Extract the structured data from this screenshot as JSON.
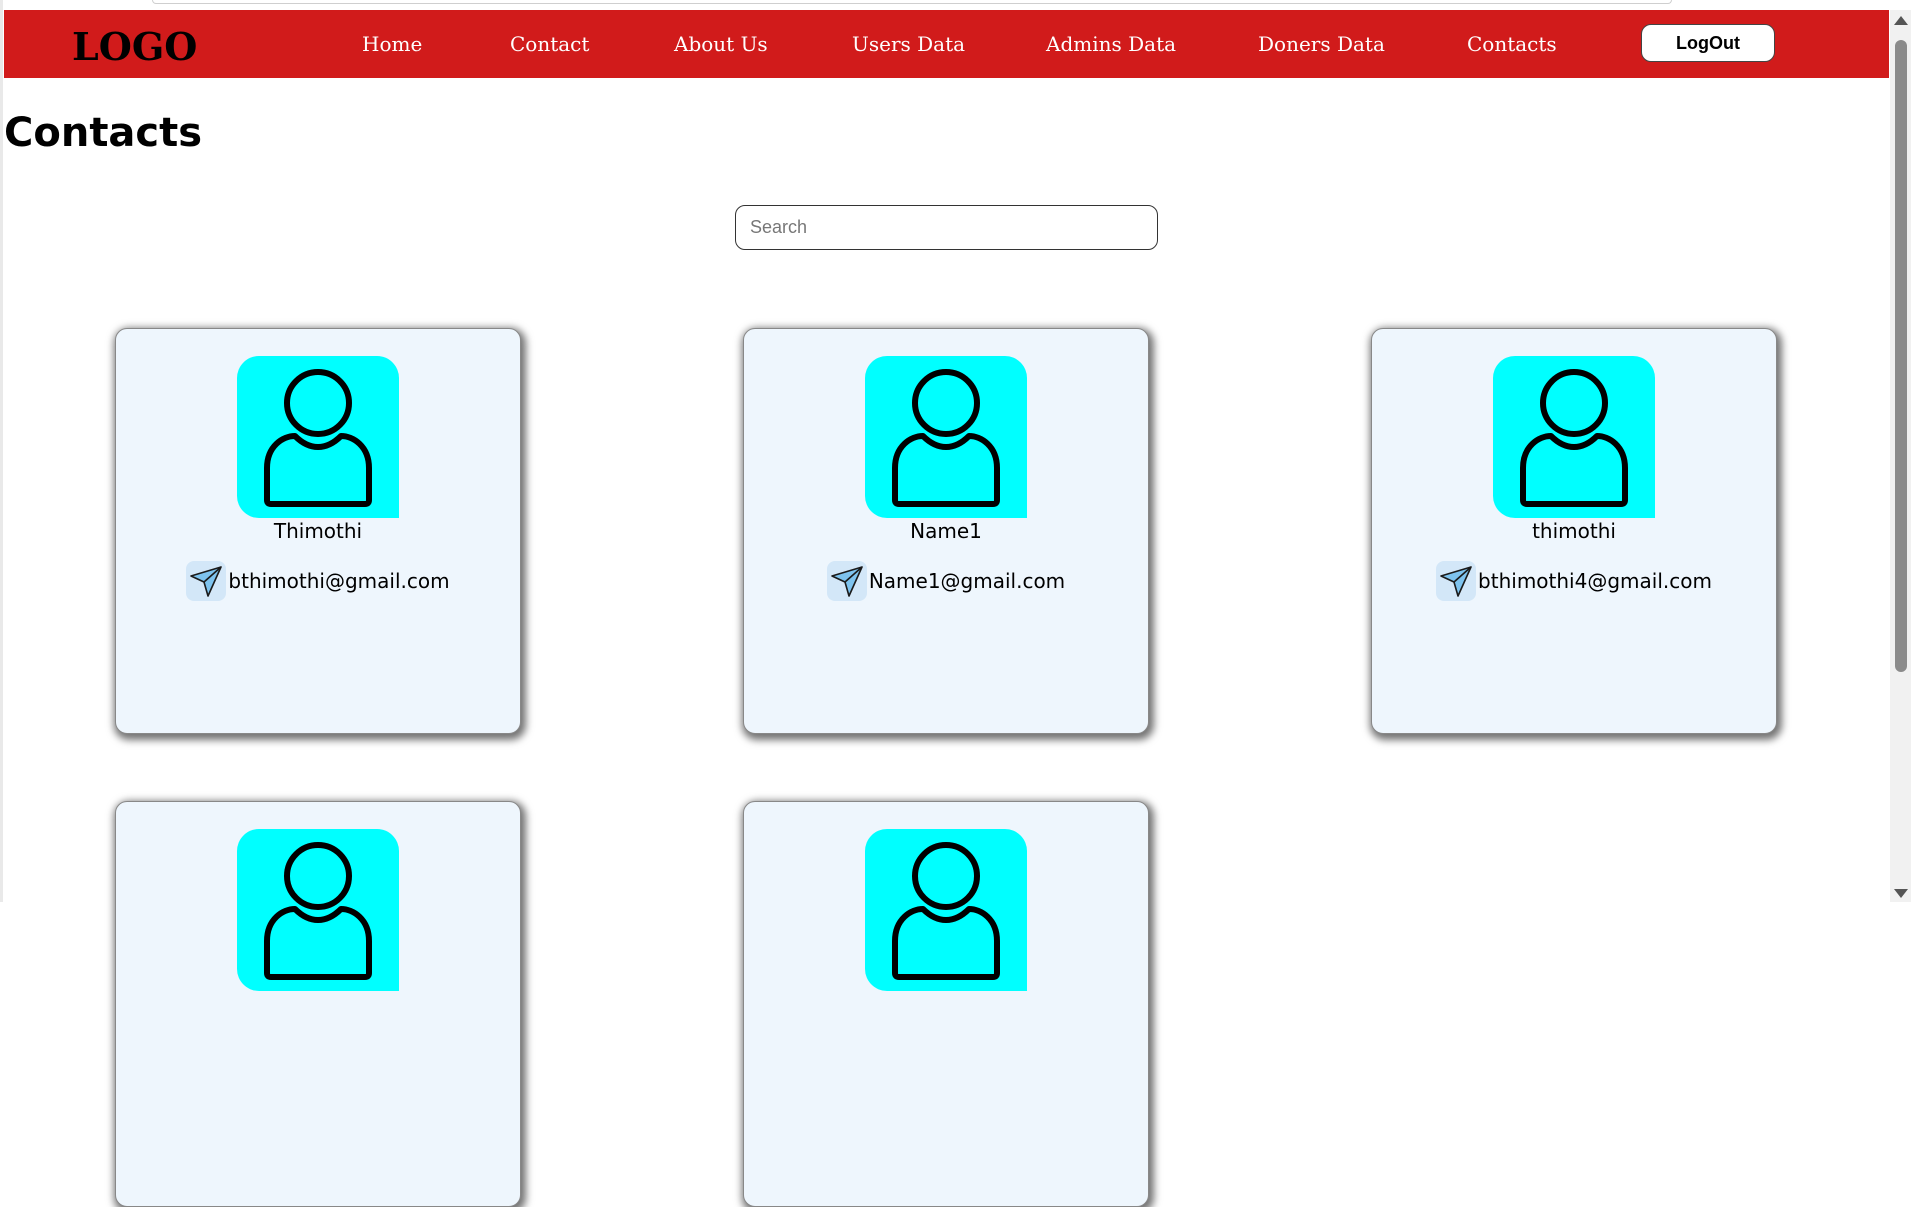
{
  "navbar": {
    "logo": "LOGO",
    "links": [
      "Home",
      "Contact",
      "About Us",
      "Users Data",
      "Admins Data",
      "Doners Data",
      "Contacts"
    ],
    "logout_label": "LogOut",
    "background_color": "#d11b1b"
  },
  "page": {
    "title": "Contacts"
  },
  "search": {
    "placeholder": "Search",
    "value": ""
  },
  "contacts": [
    {
      "name": "Thimothi",
      "email": "bthimothi@gmail.com"
    },
    {
      "name": "Name1",
      "email": "Name1@gmail.com"
    },
    {
      "name": "thimothi",
      "email": "bthimothi4@gmail.com"
    },
    {
      "name": "",
      "email": ""
    },
    {
      "name": "",
      "email": ""
    }
  ],
  "icons": {
    "avatar": "user-avatar-icon",
    "send": "paper-plane-icon"
  },
  "colors": {
    "avatar_bg": "#00ffff",
    "card_bg": "#eef6fd"
  }
}
